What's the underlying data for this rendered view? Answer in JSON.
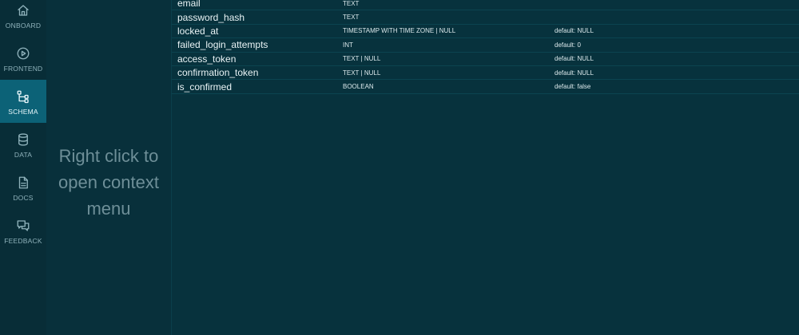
{
  "nav": {
    "items": [
      {
        "key": "onboard",
        "label": "ONBOARD",
        "icon": "home-icon",
        "active": false
      },
      {
        "key": "frontend",
        "label": "FRONTEND",
        "icon": "play-circle-icon",
        "active": false
      },
      {
        "key": "schema",
        "label": "SCHEMA",
        "icon": "schema-tree-icon",
        "active": true
      },
      {
        "key": "data",
        "label": "DATA",
        "icon": "database-icon",
        "active": false
      },
      {
        "key": "docs",
        "label": "DOCS",
        "icon": "document-icon",
        "active": false
      },
      {
        "key": "feedback",
        "label": "FEEDBACK",
        "icon": "chat-bubbles-icon",
        "active": false
      }
    ]
  },
  "hint": {
    "text": "Right click to open context menu"
  },
  "schema": {
    "rows": [
      {
        "name": "email",
        "type": "TEXT",
        "default": ""
      },
      {
        "name": "password_hash",
        "type": "TEXT",
        "default": ""
      },
      {
        "name": "locked_at",
        "type": "TIMESTAMP WITH TIME ZONE | NULL",
        "default": "default: NULL"
      },
      {
        "name": "failed_login_attempts",
        "type": "INT",
        "default": "default: 0"
      },
      {
        "name": "access_token",
        "type": "TEXT | NULL",
        "default": "default: NULL"
      },
      {
        "name": "confirmation_token",
        "type": "TEXT | NULL",
        "default": "default: NULL"
      },
      {
        "name": "is_confirmed",
        "type": "BOOLEAN",
        "default": "default: false"
      }
    ]
  },
  "colors": {
    "background": "#07323d",
    "nav_background": "#082d37",
    "nav_active": "#0c6277",
    "hint_text": "#6e8f98"
  }
}
